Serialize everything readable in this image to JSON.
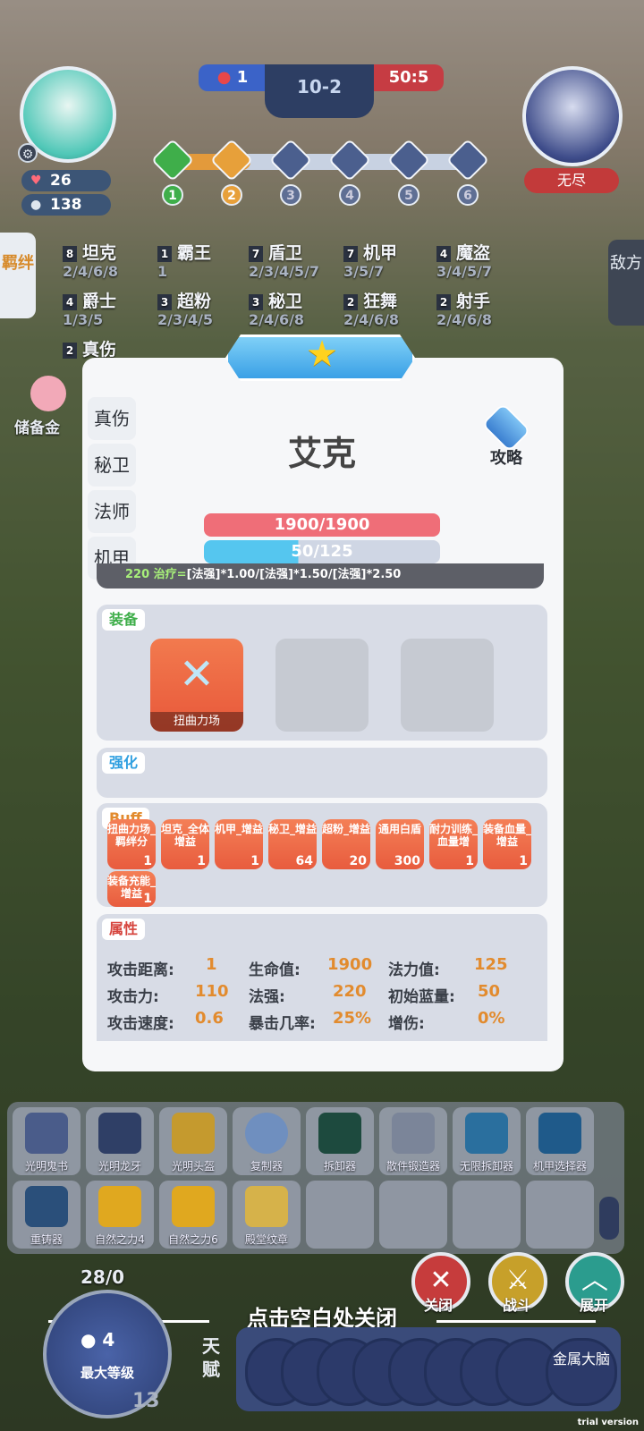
{
  "hud": {
    "hp": "26",
    "gold": "138",
    "score_left": "1",
    "round": "10-2",
    "score_right": "50:5",
    "stages": [
      "1",
      "2",
      "3",
      "4",
      "5",
      "6"
    ],
    "enemy_label": "无尽"
  },
  "synergy_tab": "羁绊",
  "enemy_tab": "敌方",
  "savings": "储备金",
  "synergies": [
    {
      "count": "8",
      "name": "坦克",
      "tiers": "2/4/6/8"
    },
    {
      "count": "1",
      "name": "霸王",
      "tiers": "1"
    },
    {
      "count": "7",
      "name": "盾卫",
      "tiers": "2/3/4/5/7"
    },
    {
      "count": "7",
      "name": "机甲",
      "tiers": "3/5/7"
    },
    {
      "count": "4",
      "name": "魔盗",
      "tiers": "3/4/5/7"
    },
    {
      "count": "4",
      "name": "爵士",
      "tiers": "1/3/5"
    },
    {
      "count": "3",
      "name": "超粉",
      "tiers": "2/3/4/5"
    },
    {
      "count": "3",
      "name": "秘卫",
      "tiers": "2/4/6/8"
    },
    {
      "count": "2",
      "name": "狂舞",
      "tiers": "2/4/6/8"
    },
    {
      "count": "2",
      "name": "射手",
      "tiers": "2/4/6/8"
    },
    {
      "count": "2",
      "name": "真伤",
      "tiers": ""
    }
  ],
  "modal": {
    "tabs": [
      "真伤",
      "秘卫",
      "法师",
      "机甲"
    ],
    "name": "艾克",
    "guide": "攻略",
    "hp_bar": "1900/1900",
    "mp_bar": "50/125",
    "heal_value": "220",
    "heal_text": "治疗=",
    "heal_formula": "[法强]*1.00/[法强]*1.50/[法强]*2.50",
    "equip_title": "装备",
    "equip_item": "扭曲力场",
    "enhance_title": "强化",
    "buff_title": "Buff",
    "buffs": [
      {
        "name": "扭曲力场_羁绊分",
        "value": "1"
      },
      {
        "name": "坦克_全体增益",
        "value": "1"
      },
      {
        "name": "机甲_增益",
        "value": "1"
      },
      {
        "name": "秘卫_增益",
        "value": "64"
      },
      {
        "name": "超粉_增益",
        "value": "20"
      },
      {
        "name": "通用白盾",
        "value": "300"
      },
      {
        "name": "耐力训练_血量增",
        "value": "1"
      },
      {
        "name": "装备血量_增益",
        "value": "1"
      },
      {
        "name": "装备充能_增益",
        "value": "1"
      }
    ],
    "attr_title": "属性",
    "attrs": [
      {
        "k": "攻击距离:",
        "v": "1"
      },
      {
        "k": "生命值:",
        "v": "1900"
      },
      {
        "k": "法力值:",
        "v": "125"
      },
      {
        "k": "攻击力:",
        "v": "110"
      },
      {
        "k": "法强:",
        "v": "220"
      },
      {
        "k": "初始蓝量:",
        "v": "50"
      },
      {
        "k": "攻击速度:",
        "v": "0.6"
      },
      {
        "k": "暴击几率:",
        "v": "25%"
      },
      {
        "k": "增伤:",
        "v": "0%"
      }
    ]
  },
  "inventory": [
    "光明鬼书",
    "光明龙牙",
    "光明头盔",
    "复制器",
    "拆卸器",
    "散件锻造器",
    "无限拆卸器",
    "机甲选择器",
    "重铸器",
    "自然之力4",
    "自然之力6",
    "殿堂纹章",
    "",
    "",
    "",
    ""
  ],
  "actions": [
    "关闭",
    "战斗",
    "展开"
  ],
  "hint": "点击空白处关闭",
  "level": {
    "top": "28/0",
    "coins": "4",
    "label": "最大等级",
    "badge": "13"
  },
  "talent_label": "天赋",
  "talent_last": "金属大脑",
  "watermark": "trial version"
}
